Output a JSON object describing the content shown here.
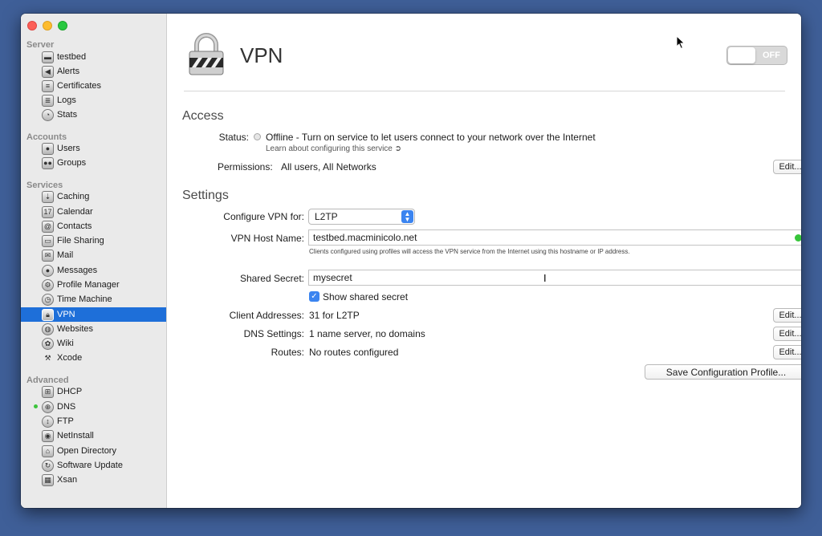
{
  "window": {
    "title": "VPN"
  },
  "sidebar": {
    "sections": [
      {
        "header": "Server",
        "items": [
          {
            "label": "testbed",
            "icon": "server-icon"
          },
          {
            "label": "Alerts",
            "icon": "megaphone-icon"
          },
          {
            "label": "Certificates",
            "icon": "certificate-icon"
          },
          {
            "label": "Logs",
            "icon": "document-icon"
          },
          {
            "label": "Stats",
            "icon": "gauge-icon"
          }
        ]
      },
      {
        "header": "Accounts",
        "items": [
          {
            "label": "Users",
            "icon": "user-icon"
          },
          {
            "label": "Groups",
            "icon": "group-icon"
          }
        ]
      },
      {
        "header": "Services",
        "items": [
          {
            "label": "Caching",
            "icon": "caching-icon"
          },
          {
            "label": "Calendar",
            "icon": "calendar-icon"
          },
          {
            "label": "Contacts",
            "icon": "contacts-icon"
          },
          {
            "label": "File Sharing",
            "icon": "folder-icon"
          },
          {
            "label": "Mail",
            "icon": "mail-icon"
          },
          {
            "label": "Messages",
            "icon": "messages-icon"
          },
          {
            "label": "Profile Manager",
            "icon": "profile-manager-icon"
          },
          {
            "label": "Time Machine",
            "icon": "time-machine-icon"
          },
          {
            "label": "VPN",
            "icon": "vpn-lock-icon",
            "selected": true
          },
          {
            "label": "Websites",
            "icon": "globe-icon"
          },
          {
            "label": "Wiki",
            "icon": "wiki-icon"
          },
          {
            "label": "Xcode",
            "icon": "hammer-icon"
          }
        ]
      },
      {
        "header": "Advanced",
        "items": [
          {
            "label": "DHCP",
            "icon": "dhcp-icon"
          },
          {
            "label": "DNS",
            "icon": "dns-icon",
            "status": "running"
          },
          {
            "label": "FTP",
            "icon": "ftp-icon"
          },
          {
            "label": "NetInstall",
            "icon": "netinstall-icon"
          },
          {
            "label": "Open Directory",
            "icon": "open-directory-icon"
          },
          {
            "label": "Software Update",
            "icon": "software-update-icon"
          },
          {
            "label": "Xsan",
            "icon": "xsan-icon"
          }
        ]
      }
    ]
  },
  "header": {
    "title": "VPN",
    "toggle_label": "OFF",
    "toggle_state": "off"
  },
  "access": {
    "heading": "Access",
    "status_label": "Status:",
    "status_value": "Offline - Turn on service to let users connect to your network over the Internet",
    "learn_link": "Learn about configuring this service",
    "permissions_label": "Permissions:",
    "permissions_value": "All users, All Networks",
    "edit_label": "Edit..."
  },
  "settings": {
    "heading": "Settings",
    "configure_label": "Configure VPN for:",
    "configure_value": "L2TP",
    "host_label": "VPN Host Name:",
    "host_value": "testbed.macminicolo.net",
    "host_hint": "Clients configured using profiles will access the VPN service from the Internet using this hostname or IP address.",
    "secret_label": "Shared Secret:",
    "secret_value": "mysecret",
    "show_secret_label": "Show shared secret",
    "show_secret_checked": true,
    "client_label": "Client Addresses:",
    "client_value": "31 for L2TP",
    "dns_label": "DNS Settings:",
    "dns_value": "1 name server, no domains",
    "routes_label": "Routes:",
    "routes_value": "No routes configured",
    "edit_label": "Edit...",
    "save_profile_label": "Save Configuration Profile..."
  },
  "colors": {
    "desktop": "#3f5f98",
    "selection": "#1e6fd9",
    "status_green": "#37c53a"
  }
}
